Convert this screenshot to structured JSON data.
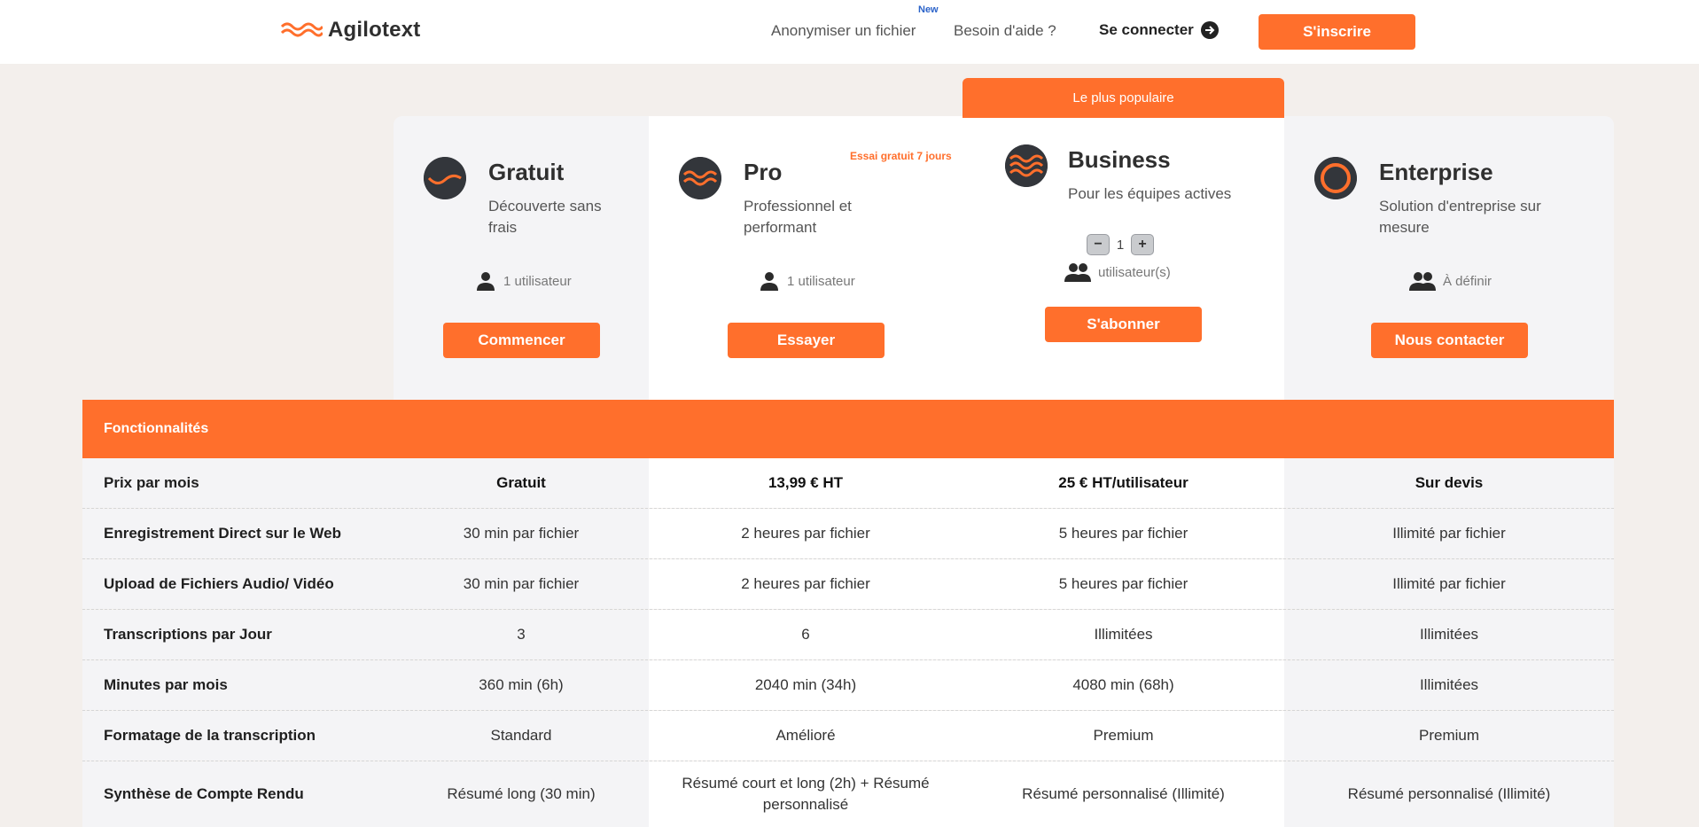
{
  "header": {
    "logo_text": "Agilotext",
    "nav": {
      "anonymize": "Anonymiser un fichier",
      "anonymize_badge": "New",
      "help": "Besoin d'aide ?",
      "login": "Se connecter",
      "signup": "S'inscrire"
    }
  },
  "colors": {
    "accent": "#ff6f2c",
    "icon_dark": "#33363b"
  },
  "plans": {
    "gratuit": {
      "name": "Gratuit",
      "description": "Découverte sans frais",
      "users": "1 utilisateur",
      "button": "Commencer",
      "icon": "single-wave-icon"
    },
    "pro": {
      "name": "Pro",
      "description": "Professionnel et performant",
      "users": "1 utilisateur",
      "button": "Essayer",
      "badge": "Essai gratuit 7 jours",
      "icon": "double-wave-icon"
    },
    "business": {
      "name": "Business",
      "description": "Pour les équipes actives",
      "users": "utilisateur(s)",
      "button": "S'abonner",
      "popular": "Le plus populaire",
      "stepper_value": "1",
      "minus": "−",
      "plus": "+",
      "icon": "triple-wave-icon"
    },
    "enterprise": {
      "name": "Enterprise",
      "description": "Solution d'entreprise sur mesure",
      "users": "À définir",
      "button": "Nous contacter",
      "icon": "ring-icon"
    }
  },
  "features": {
    "header": "Fonctionnalités",
    "rows": [
      {
        "label": "Prix par mois",
        "values": [
          "Gratuit",
          "13,99 € HT",
          "25 € HT/utilisateur",
          "Sur devis"
        ]
      },
      {
        "label": "Enregistrement Direct sur le Web",
        "values": [
          "30 min par fichier",
          "2 heures par fichier",
          "5 heures par fichier",
          "Illimité par fichier"
        ]
      },
      {
        "label": "Upload de Fichiers Audio/ Vidéo",
        "values": [
          "30 min par fichier",
          "2 heures par fichier",
          "5 heures par fichier",
          "Illimité par fichier"
        ]
      },
      {
        "label": "Transcriptions par Jour",
        "values": [
          "3",
          "6",
          "Illimitées",
          "Illimitées"
        ]
      },
      {
        "label": "Minutes par mois",
        "values": [
          "360 min (6h)",
          "2040 min (34h)",
          "4080 min (68h)",
          "Illimitées"
        ]
      },
      {
        "label": "Formatage de la transcription",
        "values": [
          "Standard",
          "Amélioré",
          "Premium",
          "Premium"
        ]
      },
      {
        "label": "Synthèse de Compte Rendu",
        "values": [
          "Résumé long (30 min)",
          "Résumé court et long (2h) + Résumé personnalisé",
          "Résumé personnalisé (Illimité)",
          "Résumé personnalisé (Illimité)"
        ]
      }
    ]
  }
}
